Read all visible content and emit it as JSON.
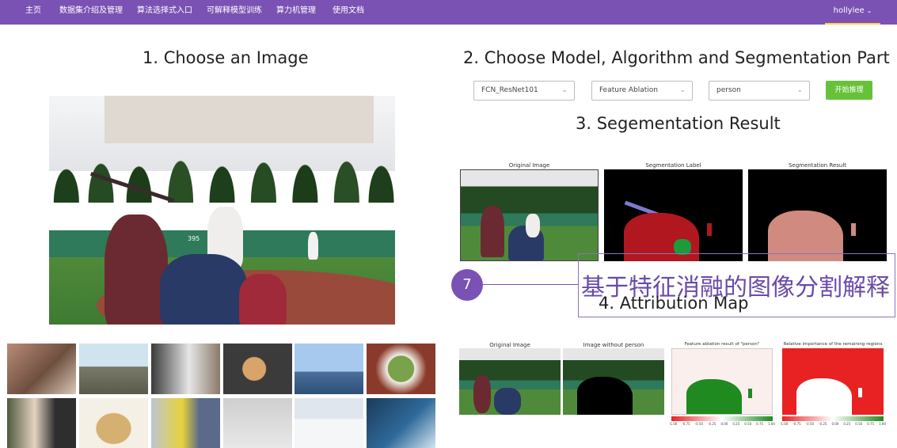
{
  "nav": {
    "items": [
      "主页",
      "数据集介绍及管理",
      "算法选择式入口",
      "可解释模型训练",
      "算力机管理",
      "使用文档"
    ],
    "user": "hollylee"
  },
  "left": {
    "heading": "1. Choose an Image",
    "jersey_number": "395"
  },
  "right": {
    "heading_model": "2. Choose Model, Algorithm and Segmentation Part",
    "selects": {
      "model": "FCN_ResNet101",
      "algorithm": "Feature Ablation",
      "part": "person"
    },
    "start_button": "开始推理",
    "heading_seg": "3. Segementation Result",
    "seg_captions": [
      "Original Image",
      "Segmentation Label",
      "Segmentation Result"
    ],
    "heading_attr": "4. Attribution Map",
    "attr_captions": [
      "Original Image",
      "Image without person",
      "Feature ablation result of \"person\"",
      "Relative importance of the remaining regions"
    ],
    "colorbar_ticks": [
      "-1.00",
      "-0.75",
      "-0.50",
      "-0.25",
      "0.00",
      "0.25",
      "0.50",
      "0.75",
      "1.00"
    ]
  },
  "annotation": {
    "badge": "7",
    "text": "基于特征消融的图像分割解释"
  },
  "colors": {
    "nav_bg": "#7a52b3",
    "start_button": "#67c23a",
    "accent_underline": "#ffd04b",
    "seg_person": "#b0171f",
    "attr_green": "#1f8a1f",
    "attr_red": "#e82222"
  }
}
